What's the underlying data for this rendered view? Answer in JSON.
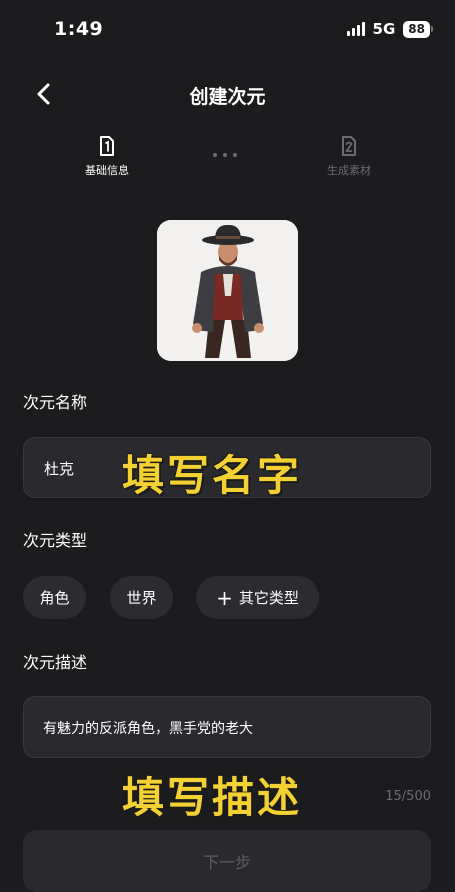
{
  "status": {
    "time": "1:49",
    "network": "5G",
    "battery": "88"
  },
  "header": {
    "title": "创建次元"
  },
  "steps": [
    {
      "label": "基础信息",
      "number": "1"
    },
    {
      "label": "生成素材",
      "number": "2"
    }
  ],
  "form": {
    "name_label": "次元名称",
    "name_value": "杜克",
    "name_overlay": "填写名字",
    "type_label": "次元类型",
    "types": [
      "角色",
      "世界",
      "其它类型"
    ],
    "desc_label": "次元描述",
    "desc_value": "有魅力的反派角色，黑手党的老大",
    "desc_overlay": "填写描述",
    "char_count": "15/500"
  },
  "footer": {
    "next_label": "下一步"
  },
  "colors": {
    "background": "#1c1c1e",
    "overlay": "#f3d132",
    "field": "#2a2a2e"
  }
}
